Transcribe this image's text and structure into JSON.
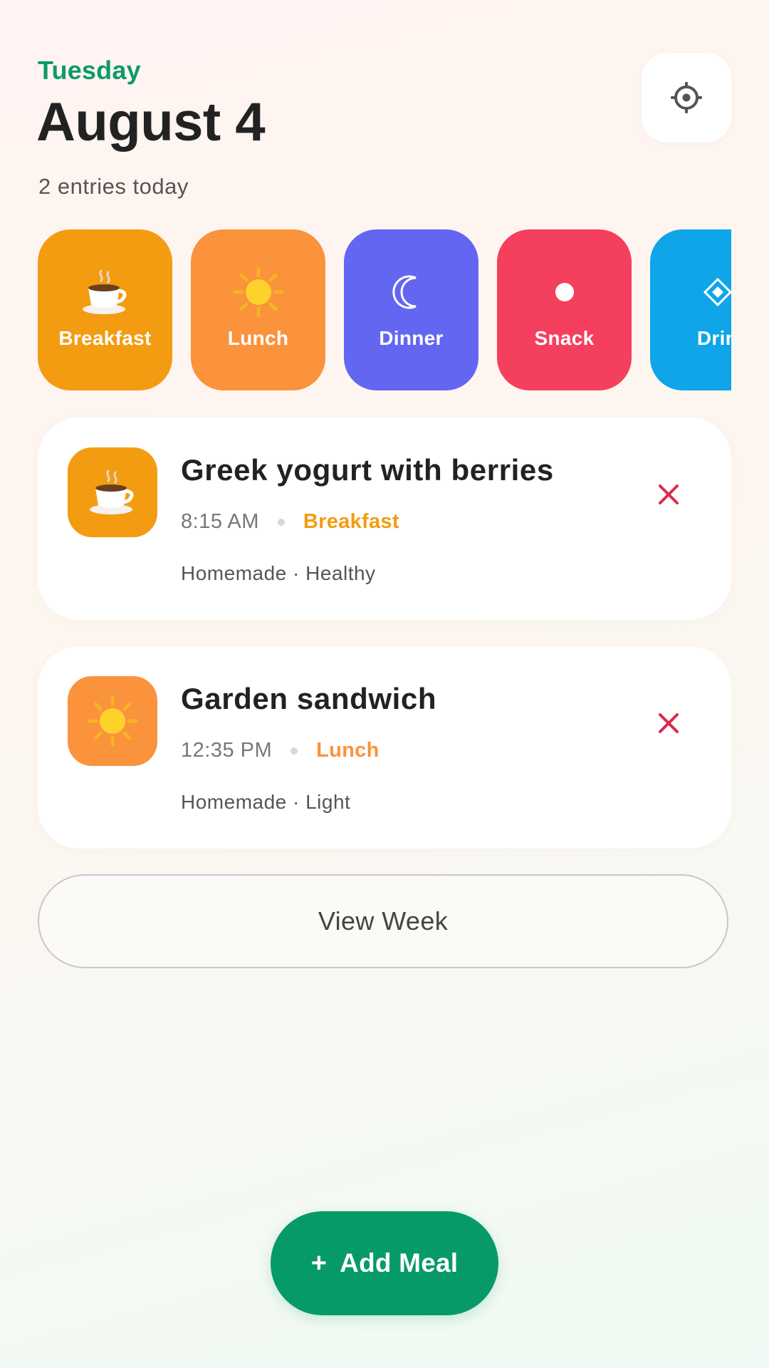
{
  "header": {
    "weekday": "Tuesday",
    "date": "August 4",
    "entries_summary": "2 entries today"
  },
  "settings": {
    "icon": "gear-icon"
  },
  "categories": [
    {
      "label": "Breakfast",
      "icon": "coffee-cup-icon",
      "color": "#f39c12"
    },
    {
      "label": "Lunch",
      "icon": "sun-icon",
      "color": "#fb923c"
    },
    {
      "label": "Dinner",
      "icon": "moon-icon",
      "color": "#6366f1"
    },
    {
      "label": "Snack",
      "icon": "dot-icon",
      "color": "#f43f5e"
    },
    {
      "label": "Drin",
      "icon": "diamond-icon",
      "color": "#0ea5e9"
    }
  ],
  "meals": [
    {
      "name": "Greek yogurt with berries",
      "time": "8:15 AM",
      "type": "Breakfast",
      "type_color": "#f39c12",
      "tags": "Homemade · Healthy",
      "icon": "coffee-cup-icon"
    },
    {
      "name": "Garden sandwich",
      "time": "12:35 PM",
      "type": "Lunch",
      "type_color": "#fb923c",
      "tags": "Homemade · Light",
      "icon": "sun-icon"
    }
  ],
  "actions": {
    "view_week": "View Week",
    "add_meal_plus": "+",
    "add_meal": "Add Meal"
  },
  "colors": {
    "accent_green": "#069a6b",
    "delete_red": "#dc2a4e"
  }
}
